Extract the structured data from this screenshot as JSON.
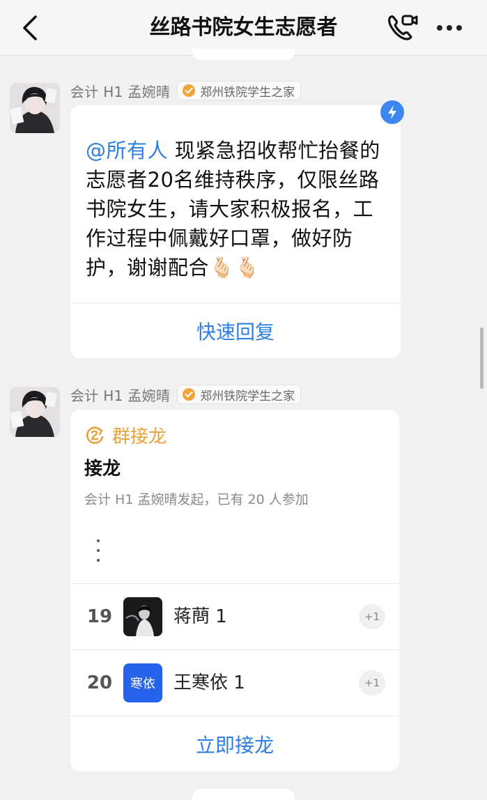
{
  "header": {
    "title": "丝路书院女生志愿者"
  },
  "messages": [
    {
      "sender": "会计 H1 孟婉晴",
      "org": "郑州铁院学生之家",
      "mention": "@所有人",
      "text": " 现紧急招收帮忙抬餐的志愿者20名维持秩序，仅限丝路书院女生，请大家积极报名，工作过程中佩戴好口罩，做好防护，谢谢配合🫰🏻🫰🏻",
      "quick_reply_label": "快速回复"
    },
    {
      "sender": "会计 H1 孟婉晴",
      "org": "郑州铁院学生之家",
      "chain": {
        "header_label": "群接龙",
        "title": "接龙",
        "subtitle": "会计 H1 孟婉晴发起，已有 20 人参加",
        "entries": [
          {
            "num": "19",
            "name": "蒋蔄 1",
            "avatar_text": "",
            "plus": "+1"
          },
          {
            "num": "20",
            "name": "王寒依 1",
            "avatar_text": "寒依",
            "plus": "+1"
          }
        ],
        "join_label": "立即接龙"
      }
    }
  ],
  "colors": {
    "link_blue": "#2d7fe3",
    "chain_orange": "#e8a23a",
    "badge_blue": "#3b86f0"
  }
}
